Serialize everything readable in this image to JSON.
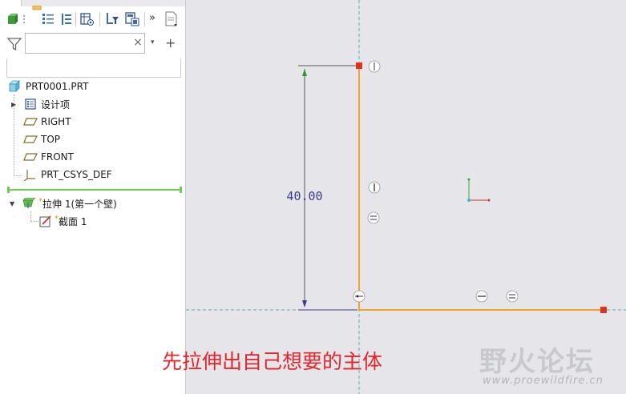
{
  "search": {
    "value": "",
    "placeholder": "",
    "clear_glyph": "×",
    "dropdown_glyph": "▾",
    "add_glyph": "+"
  },
  "toolbar": {
    "more_glyph": "»"
  },
  "tree": {
    "root": "PRT0001.PRT",
    "items": [
      {
        "label": "设计项",
        "icon": "design-items-icon"
      },
      {
        "label": "RIGHT",
        "icon": "datum-plane-icon"
      },
      {
        "label": "TOP",
        "icon": "datum-plane-icon"
      },
      {
        "label": "FRONT",
        "icon": "datum-plane-icon"
      },
      {
        "label": "PRT_CSYS_DEF",
        "icon": "csys-icon"
      }
    ],
    "feature": {
      "label": "拉伸 1(第一个壁)",
      "marker": "*"
    },
    "section": {
      "label": "截面 1",
      "marker": "*"
    }
  },
  "canvas": {
    "dimension": "40.00"
  },
  "caption": "先拉伸出自己想要的主体",
  "watermark": {
    "title": "野火论坛",
    "url": "www.proewildfire.cn"
  },
  "colors": {
    "sketch": "#f4a32a",
    "dimension": "#3a3a8c",
    "datum": "#5aa9b8",
    "caption": "#e2262b"
  }
}
